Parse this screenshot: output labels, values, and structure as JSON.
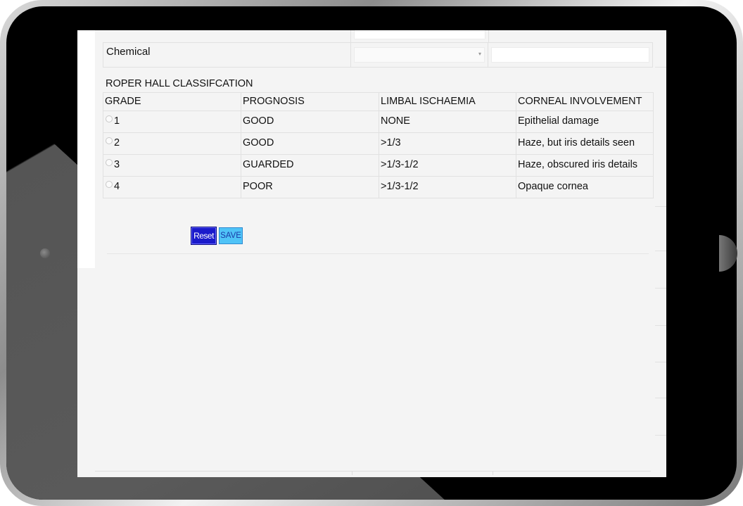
{
  "chemical": {
    "label": "Chemical",
    "select_arrow": "▾"
  },
  "roper": {
    "title": "ROPER HALL CLASSIFCATION",
    "headers": [
      "GRADE",
      "PROGNOSIS",
      "LIMBAL ISCHAEMIA",
      "CORNEAL INVOLVEMENT"
    ],
    "rows": [
      {
        "grade": "1",
        "prognosis": "GOOD",
        "limbal": "NONE",
        "corneal": "Epithelial damage"
      },
      {
        "grade": "2",
        "prognosis": "GOOD",
        "limbal": ">1/3",
        "corneal": "Haze, but iris details seen"
      },
      {
        "grade": "3",
        "prognosis": "GUARDED",
        "limbal": ">1/3-1/2",
        "corneal": "Haze, obscured iris details"
      },
      {
        "grade": "4",
        "prognosis": "POOR",
        "limbal": ">1/3-1/2",
        "corneal": "Opaque cornea"
      }
    ]
  },
  "buttons": {
    "reset_label": "Reset",
    "save_label": "SAVE"
  },
  "colors": {
    "reset_bg": "#1a1acb",
    "save_bg": "#4fc3f7"
  }
}
